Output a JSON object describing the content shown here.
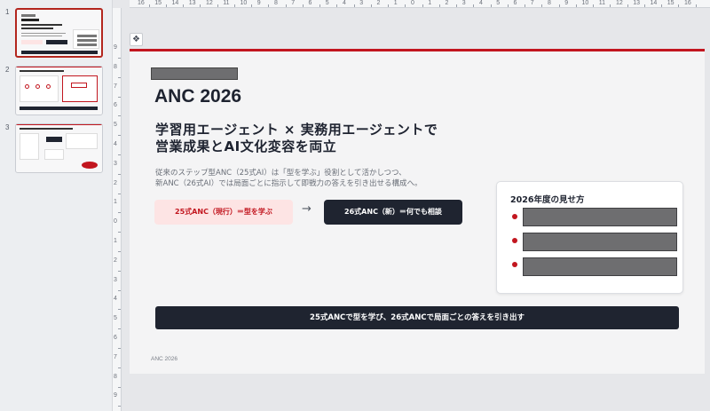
{
  "thumbnails": [
    {
      "number": "1",
      "active": true
    },
    {
      "number": "2",
      "active": false
    },
    {
      "number": "3",
      "active": false
    }
  ],
  "ruler": {
    "horizontal_labels": [
      "16",
      "15",
      "14",
      "13",
      "12",
      "11",
      "10",
      "9",
      "8",
      "7",
      "6",
      "5",
      "4",
      "3",
      "2",
      "1",
      "0",
      "1",
      "2",
      "3",
      "4",
      "5",
      "6",
      "7",
      "8",
      "9",
      "10",
      "11",
      "12",
      "13",
      "14",
      "15",
      "16"
    ],
    "vertical_labels": [
      "9",
      "8",
      "7",
      "6",
      "5",
      "4",
      "3",
      "2",
      "1",
      "0",
      "1",
      "2",
      "3",
      "4",
      "5",
      "6",
      "7",
      "8",
      "9"
    ]
  },
  "slide": {
    "title": "ANC 2026",
    "headline_lines": [
      "学習用エージェント × 実務用エージェントで",
      "営業成果とAI文化変容を両立"
    ],
    "body_lines": [
      "従来のステップ型ANC（25式AI）は「型を学ぶ」役割として活かしつつ、",
      "新ANC（26式AI）では局面ごとに指示して即戦力の答えを引き出せる構成へ。"
    ],
    "pill_current": "25式ANC（現行）＝型を学ぶ",
    "pill_new": "26式ANC（新）＝何でも相談",
    "vision_heading": "2026年度の見せ方",
    "banner": "25式ANCで型を学び、26式ANCで局面ごとの答えを引き出す",
    "footer": "ANC 2026"
  },
  "icons": {
    "layout": "layout-icon",
    "arrow": "arrow-right-icon"
  },
  "colors": {
    "accent": "#c2161f",
    "dark": "#1f2430",
    "pill_light": "#fde4e4",
    "placeholder": "#6e6e70"
  }
}
